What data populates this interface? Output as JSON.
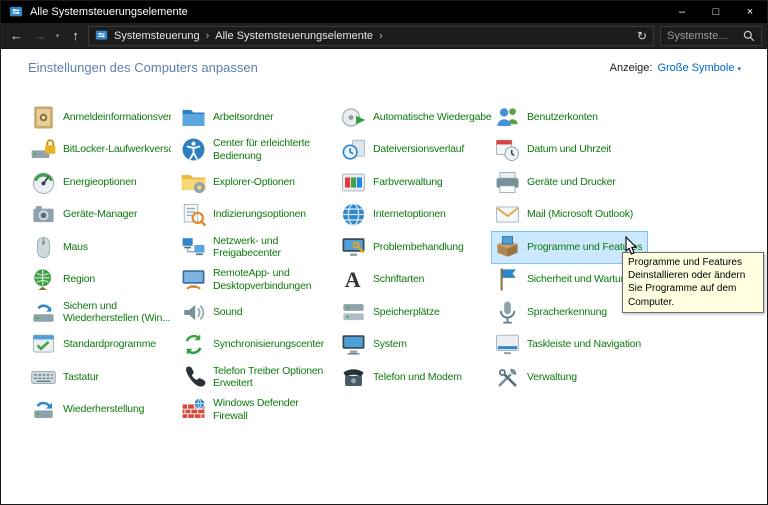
{
  "window": {
    "title": "Alle Systemsteuerungselemente"
  },
  "icons": {
    "back": "←",
    "forward": "→",
    "history_dropdown": "▾",
    "up": "↑",
    "refresh": "↻",
    "breadcrumb_separator": "›",
    "view_dropdown": "▾",
    "minimize": "–",
    "maximize": "□",
    "close": "×"
  },
  "toolbar": {
    "breadcrumb": [
      "Systemsteuerung",
      "Alle Systemsteuerungselemente"
    ],
    "search_value": "Systemste..."
  },
  "header": {
    "title": "Einstellungen des Computers anpassen",
    "view_label": "Anzeige:",
    "view_value": "Große Symbole"
  },
  "items": [
    {
      "label": "Anmeldeinformationsver...",
      "icon": "credential-manager"
    },
    {
      "label": "Arbeitsordner",
      "icon": "work-folders"
    },
    {
      "label": "Automatische Wiedergabe",
      "icon": "autoplay"
    },
    {
      "label": "Benutzerkonten",
      "icon": "user-accounts"
    },
    {
      "label": "BitLocker-Laufwerkversch...",
      "icon": "bitlocker"
    },
    {
      "label": "Center für erleichterte\nBedienung",
      "icon": "ease-of-access"
    },
    {
      "label": "Dateiversionsverlauf",
      "icon": "file-history"
    },
    {
      "label": "Datum und Uhrzeit",
      "icon": "date-time"
    },
    {
      "label": "Energieoptionen",
      "icon": "power-options"
    },
    {
      "label": "Explorer-Optionen",
      "icon": "explorer-options"
    },
    {
      "label": "Farbverwaltung",
      "icon": "color-management"
    },
    {
      "label": "Geräte und Drucker",
      "icon": "devices-printers"
    },
    {
      "label": "Geräte-Manager",
      "icon": "device-manager"
    },
    {
      "label": "Indizierungsoptionen",
      "icon": "indexing-options"
    },
    {
      "label": "Internetoptionen",
      "icon": "internet-options"
    },
    {
      "label": "Mail (Microsoft Outlook)",
      "icon": "mail"
    },
    {
      "label": "Maus",
      "icon": "mouse"
    },
    {
      "label": "Netzwerk- und\nFreigabecenter",
      "icon": "network-sharing"
    },
    {
      "label": "Problembehandlung",
      "icon": "troubleshooting"
    },
    {
      "label": "Programme und Features",
      "icon": "programs-features",
      "highlighted": true
    },
    {
      "label": "Region",
      "icon": "region"
    },
    {
      "label": "RemoteApp- und\nDesktopverbindungen",
      "icon": "remoteapp"
    },
    {
      "label": "Schriftarten",
      "icon": "fonts"
    },
    {
      "label": "Sicherheit und Wartung",
      "icon": "security-maintenance"
    },
    {
      "label": "Sichern und\nWiederherstellen (Win...",
      "icon": "backup-restore"
    },
    {
      "label": "Sound",
      "icon": "sound"
    },
    {
      "label": "Speicherplätze",
      "icon": "storage-spaces"
    },
    {
      "label": "Spracherkennung",
      "icon": "speech-recognition"
    },
    {
      "label": "Standardprogramme",
      "icon": "default-programs"
    },
    {
      "label": "Synchronisierungscenter",
      "icon": "sync-center"
    },
    {
      "label": "System",
      "icon": "system"
    },
    {
      "label": "Taskleiste und Navigation",
      "icon": "taskbar"
    },
    {
      "label": "Tastatur",
      "icon": "keyboard"
    },
    {
      "label": "Telefon Treiber Optionen\nErweitert",
      "icon": "phone-driver"
    },
    {
      "label": "Telefon und Modem",
      "icon": "phone-modem"
    },
    {
      "label": "Verwaltung",
      "icon": "admin-tools"
    },
    {
      "label": "Wiederherstellung",
      "icon": "recovery"
    },
    {
      "label": "Windows Defender\nFirewall",
      "icon": "firewall"
    }
  ],
  "tooltip": {
    "title": "Programme und Features",
    "body": "Deinstallieren oder ändern Sie Programme auf dem Computer."
  },
  "colors": {
    "item_link": "#0d7a0d",
    "view_link": "#0066cc",
    "header_title": "#5b7fae",
    "highlight_bg": "#cce8ff",
    "highlight_border": "#7fc3f5",
    "tooltip_bg": "#ffffe1",
    "titlebar_bg": "#000000",
    "toolbar_bg": "#1f1f1f"
  }
}
